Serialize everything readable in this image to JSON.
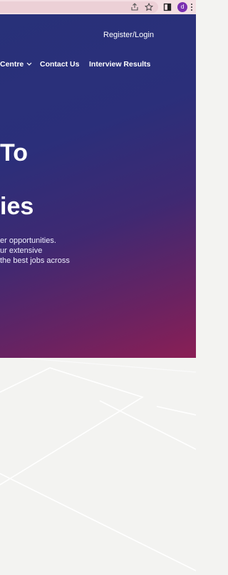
{
  "browser": {
    "profile_initial": "d",
    "icons": [
      "share-icon",
      "star-icon",
      "sidebar-icon",
      "profile-avatar",
      "menu-icon"
    ]
  },
  "header": {
    "register_login": "Register/Login"
  },
  "nav": {
    "items": [
      {
        "label": "Centre",
        "has_dropdown": true
      },
      {
        "label": "Contact Us",
        "has_dropdown": false
      },
      {
        "label": "Interview Results",
        "has_dropdown": false
      }
    ]
  },
  "hero": {
    "title_line_1": "To",
    "title_line_2": "ies",
    "description_lines": [
      "er opportunities.",
      "ur extensive",
      "the best jobs across"
    ]
  },
  "colors": {
    "hero_start": "#283179",
    "hero_end": "#8a1f55",
    "lower_bg": "#f3f3f1",
    "text": "#ffffff"
  }
}
